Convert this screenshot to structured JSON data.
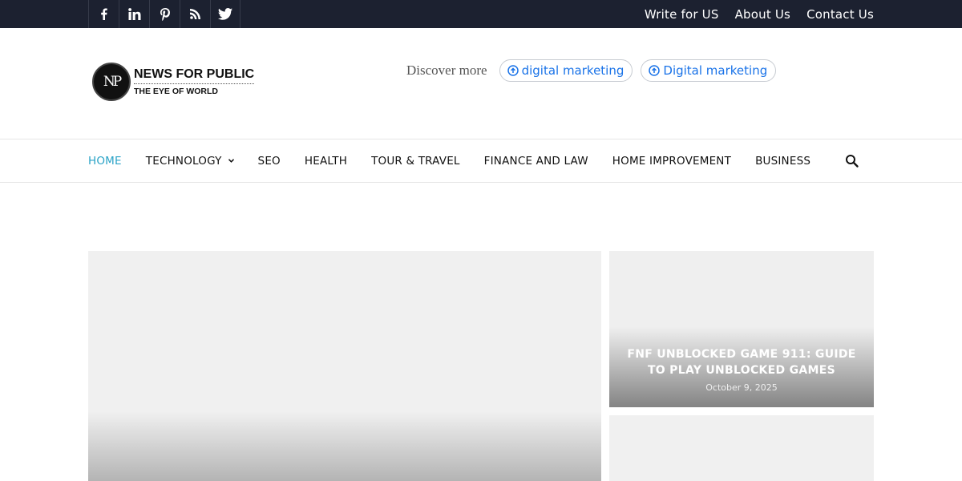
{
  "topbar": {
    "social": [
      {
        "name": "facebook-icon"
      },
      {
        "name": "linkedin-icon"
      },
      {
        "name": "pinterest-icon"
      },
      {
        "name": "rss-icon"
      },
      {
        "name": "twitter-icon"
      }
    ],
    "links": [
      "Write for US",
      "About Us",
      "Contact Us"
    ]
  },
  "logo": {
    "mark": "NP",
    "name": "NEWS FOR PUBLIC",
    "tagline": "THE EYE OF WORLD"
  },
  "discover": {
    "label": "Discover more",
    "chips": [
      "digital marketing",
      "Digital marketing"
    ]
  },
  "nav": {
    "items": [
      "HOME",
      "TECHNOLOGY",
      "SEO",
      "HEALTH",
      "TOUR & TRAVEL",
      "FINANCE AND LAW",
      "HOME IMPROVEMENT",
      "BUSINESS"
    ],
    "active": "HOME",
    "dropdown_icon": "chevron-down-icon",
    "search_icon": "search-icon"
  },
  "featured": {
    "side_post": {
      "title": "FNF UNBLOCKED GAME 911: GUIDE TO PLAY UNBLOCKED GAMES",
      "date": "October 9, 2025"
    }
  },
  "colors": {
    "topbar_bg": "#1c2130",
    "accent": "#2aa3c7",
    "chip_text": "#1a73e8"
  }
}
